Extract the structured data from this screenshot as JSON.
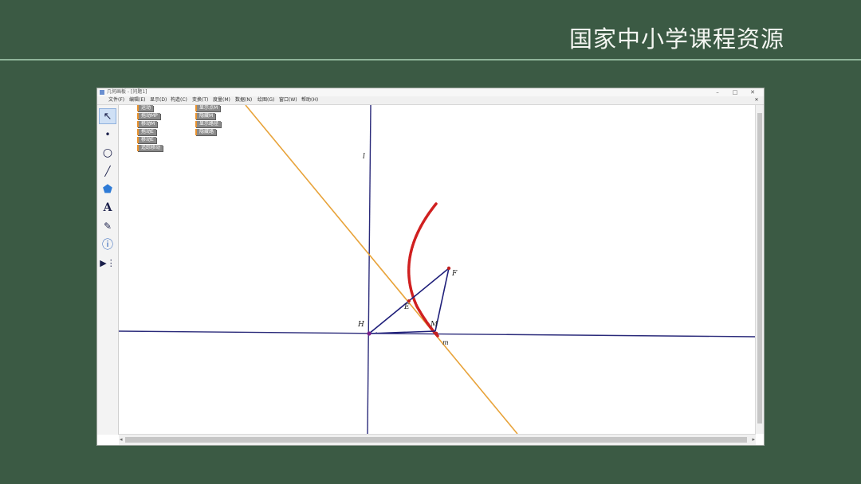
{
  "banner": {
    "title": "国家中小学课程资源"
  },
  "window": {
    "title": "几何画板 - [问题1]",
    "controls": {
      "minimize": "–",
      "maximize": "□",
      "close": "✕"
    }
  },
  "menu": {
    "items": [
      "文件(F)",
      "编辑(E)",
      "显示(D)",
      "构造(C)",
      "变换(T)",
      "度量(M)",
      "数据(N)",
      "绘图(G)",
      "窗口(W)",
      "帮助(H)"
    ],
    "close": "✕"
  },
  "toolbox": {
    "tools": [
      {
        "name": "select-arrow-tool",
        "glyph": "↖"
      },
      {
        "name": "point-tool",
        "glyph": "•"
      },
      {
        "name": "compass-tool",
        "glyph": "○"
      },
      {
        "name": "straightedge-tool",
        "glyph": "╱"
      },
      {
        "name": "polygon-tool",
        "glyph": "⬟"
      },
      {
        "name": "text-tool",
        "glyph": "A"
      },
      {
        "name": "marker-tool",
        "glyph": "✎"
      },
      {
        "name": "information-tool",
        "glyph": "ⓘ"
      },
      {
        "name": "custom-tool",
        "glyph": "▶⋮"
      }
    ]
  },
  "sketch": {
    "action_buttons_left": [
      "运动",
      "拖动MP",
      "移动M",
      "拖动E",
      "移动E",
      "追踪移动"
    ],
    "action_buttons_right": [
      "显示点M",
      "隐藏M",
      "显示路径",
      "隐藏路"
    ],
    "labels": {
      "l": "l",
      "H": "H",
      "E": "E",
      "F": "F",
      "M": "M",
      "m": "m"
    }
  },
  "colors": {
    "background": "#3b5a44",
    "axis": "#2a2a7a",
    "orange_line": "#e8a33a",
    "triangle": "#1f1f7a",
    "trace": "#d02020",
    "point": "#7a1f8a"
  }
}
